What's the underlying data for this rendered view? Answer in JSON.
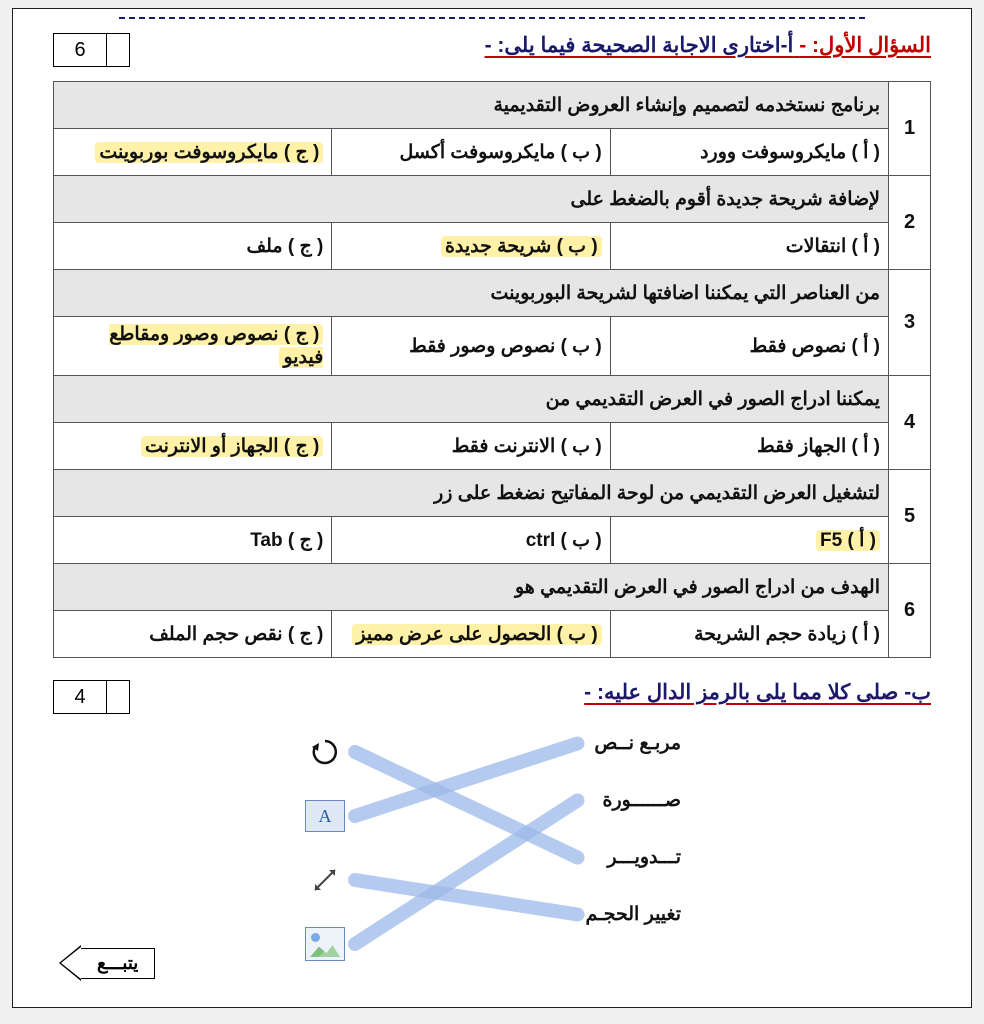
{
  "top_rule": true,
  "section_a": {
    "lead": "السؤال الأول: -",
    "title": "أ-اختارى الاجابة الصحيحة فيما يلى: -",
    "score": "6"
  },
  "mcq": [
    {
      "n": "1",
      "q": "برنامج نستخدمه لتصميم وإنشاء العروض التقديمية",
      "a": "( أ )  مايكروسوفت وورد",
      "b": "( ب ) مايكروسوفت أكسل",
      "c": "( ج ) مايكروسوفت بوربوينت",
      "correct": "c"
    },
    {
      "n": "2",
      "q": "لإضافة شريحة جديدة أقوم بالضغط على",
      "a": "( أ ) انتقالات",
      "b": "( ب ) شريحة جديدة",
      "c": "( ج ) ملف",
      "correct": "b"
    },
    {
      "n": "3",
      "q": "من العناصر التي يمكننا اضافتها لشريحة البوربوينت",
      "a": "( أ ) نصوص فقط",
      "b": "( ب ) نصوص وصور فقط",
      "c": "( ج ) نصوص وصور ومقاطع فيديو",
      "correct": "c"
    },
    {
      "n": "4",
      "q": "يمكننا ادراج الصور في العرض التقديمي من",
      "a": "( أ ) الجهاز فقط",
      "b": "( ب ) الانترنت فقط",
      "c": "( ج ) الجهاز أو الانترنت",
      "correct": "c"
    },
    {
      "n": "5",
      "q": "لتشغيل العرض التقديمي من لوحة المفاتيح نضغط على زر",
      "a": "( أ )  F5",
      "b": "( ب ) ctrl",
      "c": "( ج ) Tab",
      "correct": "a"
    },
    {
      "n": "6",
      "q": "الهدف من ادراج الصور في العرض التقديمي هو",
      "a": "( أ ) زيادة حجم الشريحة",
      "b": "( ب ) الحصول على عرض مميز",
      "c": "( ج ) نقص حجم الملف",
      "correct": "b"
    }
  ],
  "section_b": {
    "title": "ب- صلى كلا مما يلى بالرمز الدال عليه: -",
    "score": "4",
    "labels": [
      "مربـع نــص",
      "صــــــورة",
      "تـــدويـــر",
      "تغيير الحجـم"
    ],
    "icons": [
      "rotate",
      "textbox",
      "resize",
      "image"
    ],
    "matches": [
      {
        "label": 0,
        "icon": 1
      },
      {
        "label": 1,
        "icon": 3
      },
      {
        "label": 2,
        "icon": 0
      },
      {
        "label": 3,
        "icon": 2
      }
    ]
  },
  "continue": "يتبـــع"
}
